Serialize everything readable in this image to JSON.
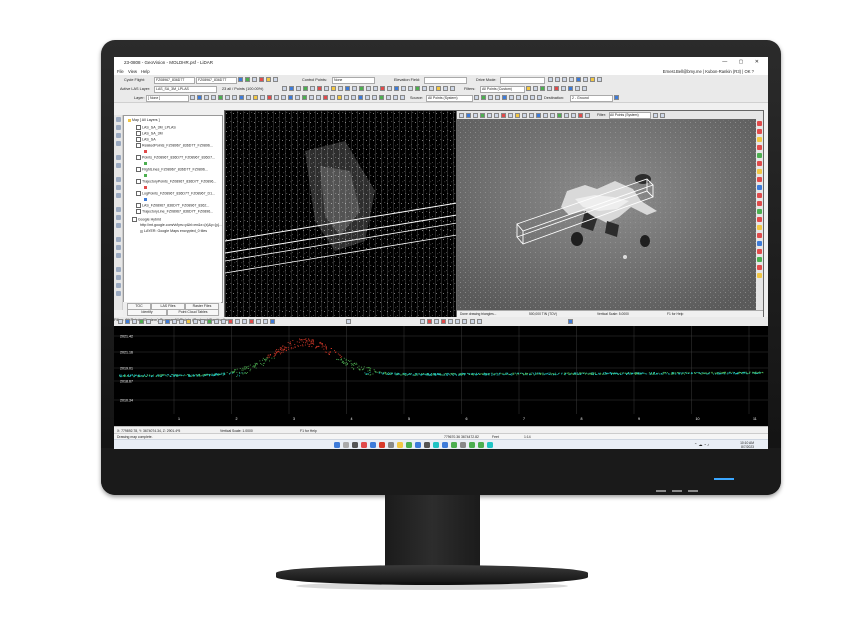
{
  "window": {
    "title": "23-0808 - GeoVision - MOLDHR.psf - LiDAR",
    "menu": [
      "File",
      "View",
      "Help"
    ],
    "user": "Ernest.Bell@bmy.me | Kubon-Rankin (R3) | OK ?"
  },
  "toolbar1": {
    "cycle_label": "Cycle Flight:",
    "cycle_value": "FZ08967_836D7T",
    "cycle_value2": "FZ08967_836D7T",
    "control_points_label": "Control Points:",
    "control_points_value": "None",
    "elevation_label": "Elevation Field:",
    "drive_mode_label": "Drive Mode:"
  },
  "toolbar2": {
    "active_layer_label": "Active LAS Layer:",
    "active_layer_value": "LAS_SA_3M_LPLAS",
    "points_text": "23 all / Points (100.00%)",
    "filters_label": "Filters:",
    "filters_value": "All Points (Custom)"
  },
  "toolbar3": {
    "layer_label": "Layer:",
    "layer_value": "[ None ]",
    "source_label": "Source:",
    "source_value": "All Points (System)",
    "destination_label": "Destination:",
    "destination_value": "2 - Ground"
  },
  "layers": [
    {
      "name": "Map [ All Layers ]",
      "color": "#f2c744"
    },
    {
      "name": "LAS_SA_3M_LPLAS",
      "color": "#cccccc"
    },
    {
      "name": "LAS_SA_3M",
      "color": "#cccccc"
    },
    {
      "name": "LAS_SA",
      "color": "#cccccc"
    },
    {
      "name": "RelatedPoints_FZ08967_836D7T_FZ0896...",
      "color": "#e14b4b"
    },
    {
      "name": "Points_FZ08967_836D7T_FZ08967_836D7...",
      "color": "#4caf50"
    },
    {
      "name": "FlightLines_FZ08967_836D7T_FZ0896...",
      "color": "#4caf50"
    },
    {
      "name": "TrajectoryPoints_FZ08967_836D7T_FZ0896...",
      "color": "#e14b4b"
    },
    {
      "name": "LogPoints_FZ08967_836D7T_FZ08967_D1...",
      "color": "#3d7bd9"
    },
    {
      "name": "LAS_FZ08967_836D7T_FZ08967_8362...",
      "color": "#cccccc"
    },
    {
      "name": "TrajectoryLine_FZ08967_836D7T_FZ0896...",
      "color": "#cccccc"
    },
    {
      "name": "Google Hybrid",
      "color": "#cccccc"
    },
    {
      "name": "http://mt.google.com/vt/lyrs=y&hl=en&x={x}&y={y}...",
      "color": "#ffffff"
    },
    {
      "name": "LAYER: Google Maps encrypted_0 tiles",
      "color": "#ffffff"
    }
  ],
  "layer_tabs": {
    "toc": "TOC",
    "las_files": "LAS Files",
    "raster_files": "Raster Files",
    "identify": "Identify",
    "point_cloud": "Point Cloud Tables"
  },
  "right_view": {
    "filter_label": "Filter:",
    "filter_value": "All Points (System)",
    "status_left": "Done drawing triangles...",
    "status_mid": "500,000 TIN (TOV)",
    "status_scale": "Vertical Scale: 5.0000",
    "status_help": "F1 for Help"
  },
  "profile_toolbar": {
    "filter_label": "Filter:",
    "filter_value": "All Points (System)",
    "source_label": "Source:",
    "source_value": "All Points (System)",
    "destination_label": "Destination:"
  },
  "chart_data": {
    "type": "scatter",
    "y_ticks": [
      "2021.42",
      "2021.16",
      "2019.01",
      "2018.67",
      "2010.34"
    ],
    "x_ticks": [
      "1",
      "2",
      "3",
      "4",
      "5",
      "6",
      "7",
      "8",
      "9",
      "10",
      "11"
    ],
    "series": [
      {
        "color": "#d83a2a",
        "note_colors": "high"
      },
      {
        "color": "#4caf50"
      },
      {
        "color": "#20c4c4"
      }
    ],
    "grid": true
  },
  "profile_status": {
    "coords": "X: 779892.78, Y: 3674074.34, Z: 2901.4*5",
    "scale": "Vertical Scale: 1.0000",
    "help": "F1 for Help"
  },
  "status": {
    "left": "Drawing map complete.",
    "coords": "779670.36 3674472.82",
    "units": "Feet",
    "zoom": "1:14"
  },
  "clock": {
    "time": "10:10 AM",
    "date": "8/7/2023"
  }
}
